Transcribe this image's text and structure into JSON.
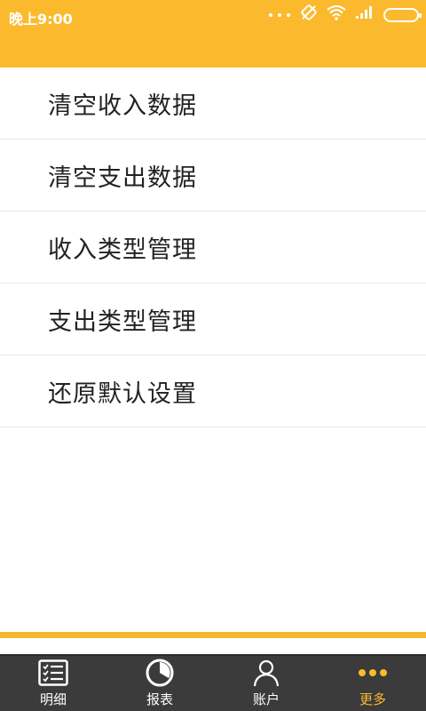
{
  "status_bar": {
    "time": "晚上9:00"
  },
  "menu": {
    "items": [
      {
        "label": "清空收入数据"
      },
      {
        "label": "清空支出数据"
      },
      {
        "label": "收入类型管理"
      },
      {
        "label": "支出类型管理"
      },
      {
        "label": "还原默认设置"
      }
    ]
  },
  "tabbar": {
    "tabs": [
      {
        "label": "明细",
        "icon": "list-icon",
        "active": false
      },
      {
        "label": "报表",
        "icon": "pie-chart-icon",
        "active": false
      },
      {
        "label": "账户",
        "icon": "user-icon",
        "active": false
      },
      {
        "label": "更多",
        "icon": "more-dots-icon",
        "active": true
      }
    ]
  },
  "colors": {
    "accent": "#FBBA2E",
    "tabbar_bg": "#3B3B3B",
    "active_tab": "#FBBA2E"
  }
}
